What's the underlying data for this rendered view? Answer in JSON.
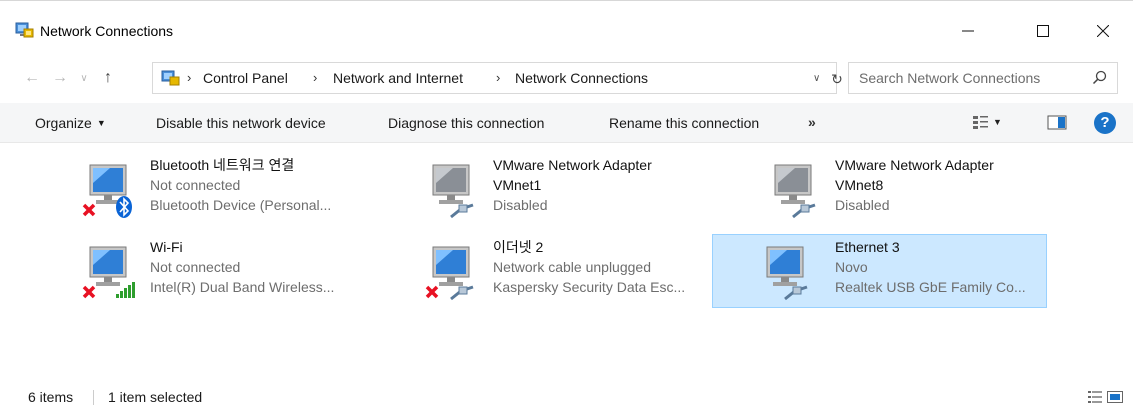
{
  "window": {
    "title": "Network Connections"
  },
  "address": {
    "crumbs": [
      "Control Panel",
      "Network and Internet",
      "Network Connections"
    ],
    "search_placeholder": "Search Network Connections"
  },
  "toolbar": {
    "organize": "Organize",
    "disable": "Disable this network device",
    "diagnose": "Diagnose this connection",
    "rename": "Rename this connection",
    "more": "»"
  },
  "items": [
    {
      "name": "Bluetooth 네트워크 연결",
      "name2": "",
      "status": "Not connected",
      "device": "Bluetooth Device (Personal...",
      "badge": "bluetooth",
      "error": true,
      "selected": false
    },
    {
      "name": "VMware Network Adapter",
      "name2": "VMnet1",
      "status": "Disabled",
      "device": "",
      "badge": "cable",
      "error": false,
      "selected": false
    },
    {
      "name": "VMware Network Adapter",
      "name2": "VMnet8",
      "status": "Disabled",
      "device": "",
      "badge": "cable",
      "error": false,
      "selected": false
    },
    {
      "name": "Wi-Fi",
      "name2": "",
      "status": "Not connected",
      "device": "Intel(R) Dual Band Wireless...",
      "badge": "wifi",
      "error": true,
      "selected": false
    },
    {
      "name": "이더넷 2",
      "name2": "",
      "status": "Network cable unplugged",
      "device": "Kaspersky Security Data Esc...",
      "badge": "cable",
      "error": true,
      "selected": false
    },
    {
      "name": "Ethernet 3",
      "name2": "",
      "status": "Novo",
      "device": "Realtek USB GbE Family Co...",
      "badge": "cable",
      "error": false,
      "selected": true
    }
  ],
  "status": {
    "count": "6 items",
    "selected": "1 item selected"
  },
  "colors": {
    "accent": "#1a73c8",
    "selection_bg": "#cce8ff",
    "selection_border": "#99d1ff",
    "error_red": "#e81123",
    "bluetooth_blue": "#0a64d6",
    "wifi_green": "#2e9e2e"
  }
}
